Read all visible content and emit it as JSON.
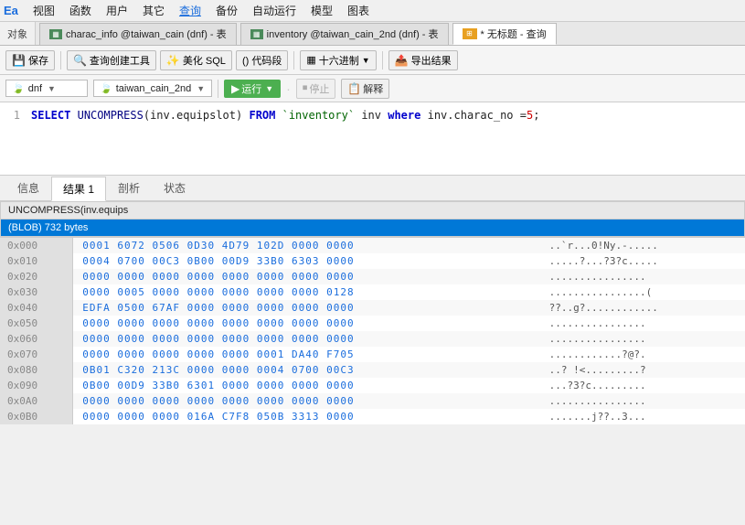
{
  "menu": {
    "items": [
      "视图",
      "函数",
      "用户",
      "其它",
      "查询",
      "备份",
      "自动运行",
      "模型",
      "图表"
    ]
  },
  "tabs": [
    {
      "id": "charac",
      "label": "charac_info @taiwan_cain (dnf) - 表",
      "icon": "table",
      "active": false
    },
    {
      "id": "inventory",
      "label": "inventory @taiwan_cain_2nd (dnf) - 表",
      "icon": "table",
      "active": false
    },
    {
      "id": "query",
      "label": "* 无标题 - 查询",
      "icon": "query",
      "active": true
    }
  ],
  "object_label": "对象",
  "toolbar": {
    "save": "保存",
    "query_builder": "查询创建工具",
    "beautify": "美化 SQL",
    "code_snippet": "() 代码段",
    "hex": "十六进制",
    "export": "导出结果"
  },
  "selectors": {
    "db1": "dnf",
    "db2": "taiwan_cain_2nd"
  },
  "run_btn": "运行",
  "stop_btn": "停止",
  "explain_btn": "解释",
  "code": {
    "line1": "SELECT UNCOMPRESS(inv.equipslot) FROM `inventory` inv where inv.charac_no =5;"
  },
  "result_tabs": [
    "信息",
    "结果 1",
    "剖析",
    "状态"
  ],
  "active_result_tab": "结果 1",
  "result_column": "UNCOMPRESS(inv.equips",
  "result_blob": "(BLOB) 732 bytes",
  "hex_data": [
    {
      "addr": "0x000",
      "bytes": "0001  6072  0506  0D30  4D79  102D  0000  0000",
      "ascii": "..`r...0!Ny.-....."
    },
    {
      "addr": "0x010",
      "bytes": "0004  0700  00C3  0B00  00D9  33B0  6303  0000",
      "ascii": ".....?...?3?c....."
    },
    {
      "addr": "0x020",
      "bytes": "0000  0000  0000  0000  0000  0000  0000  0000",
      "ascii": "................"
    },
    {
      "addr": "0x030",
      "bytes": "0000  0005  0000  0000  0000  0000  0000  0128",
      "ascii": "................("
    },
    {
      "addr": "0x040",
      "bytes": "EDFA  0500  67AF  0000  0000  0000  0000  0000",
      "ascii": "??..g?............"
    },
    {
      "addr": "0x050",
      "bytes": "0000  0000  0000  0000  0000  0000  0000  0000",
      "ascii": "................"
    },
    {
      "addr": "0x060",
      "bytes": "0000  0000  0000  0000  0000  0000  0000  0000",
      "ascii": "................"
    },
    {
      "addr": "0x070",
      "bytes": "0000  0000  0000  0000  0000  0001  DA40  F705",
      "ascii": "............?@?."
    },
    {
      "addr": "0x080",
      "bytes": "0B01  C320  213C  0000  0000  0004  0700  00C3",
      "ascii": "..? !<.........?"
    },
    {
      "addr": "0x090",
      "bytes": "0B00  00D9  33B0  6301  0000  0000  0000  0000",
      "ascii": "...?3?c........."
    },
    {
      "addr": "0x0A0",
      "bytes": "0000  0000  0000  0000  0000  0000  0000  0000",
      "ascii": "................"
    },
    {
      "addr": "0x0B0",
      "bytes": "0000  0000  0000  016A  C7F8  050B  3313  0000",
      "ascii": ".......j??..3..."
    }
  ]
}
